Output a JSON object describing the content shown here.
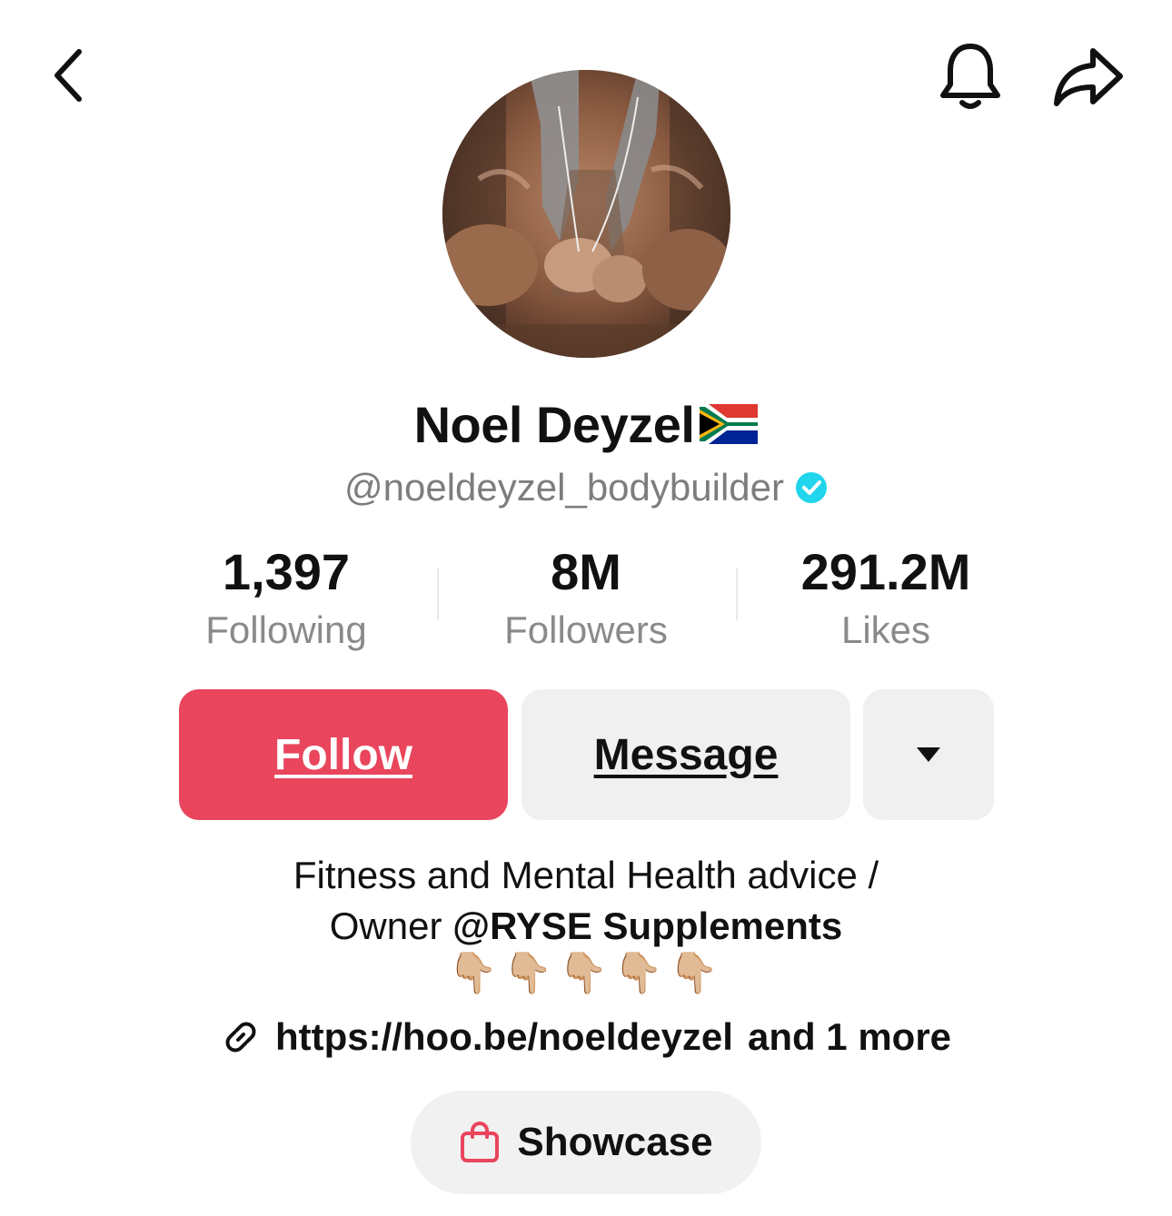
{
  "header": {
    "back_icon": "chevron-left-icon",
    "bell_icon": "bell-icon",
    "share_icon": "share-arrow-icon"
  },
  "profile": {
    "display_name": "Noel Deyzel",
    "flag": "🇿🇦",
    "handle": "@noeldeyzel_bodybuilder",
    "verified_color": "#20d5ec"
  },
  "stats": [
    {
      "value": "1,397",
      "label": "Following"
    },
    {
      "value": "8M",
      "label": "Followers"
    },
    {
      "value": "291.2M",
      "label": "Likes"
    }
  ],
  "actions": {
    "follow_label": "Follow",
    "message_label": "Message",
    "more_icon": "caret-down-icon",
    "follow_color": "#e9455c"
  },
  "bio": {
    "line1": "Fitness and Mental Health advice /",
    "line2_prefix": "Owner ",
    "line2_mention": "@RYSE Supplements",
    "emoji": "👇🏼👇🏼👇🏼👇🏼👇🏼"
  },
  "link": {
    "url": "https://hoo.be/noeldeyzel",
    "more": "and 1 more"
  },
  "showcase": {
    "label": "Showcase"
  }
}
